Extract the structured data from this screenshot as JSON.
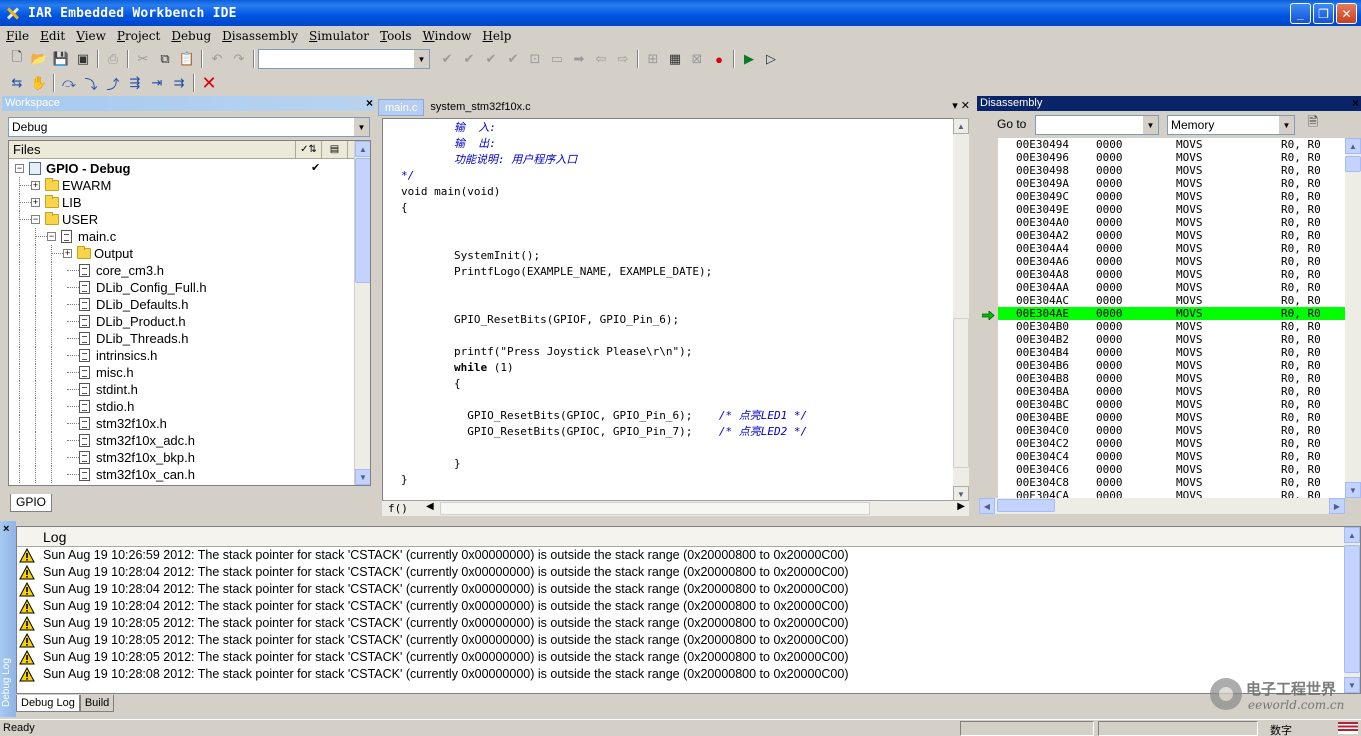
{
  "window": {
    "title": "IAR Embedded Workbench IDE"
  },
  "menu": [
    "File",
    "Edit",
    "View",
    "Project",
    "Debug",
    "Disassembly",
    "Simulator",
    "Tools",
    "Window",
    "Help"
  ],
  "workspace": {
    "header": "Workspace",
    "config": "Debug",
    "files_header": "Files",
    "bottom_tab": "GPIO",
    "tree": [
      {
        "label": "GPIO - Debug",
        "depth": 0,
        "type": "project",
        "expander": "-",
        "checked": true
      },
      {
        "label": "EWARM",
        "depth": 1,
        "type": "folder",
        "expander": "+"
      },
      {
        "label": "LIB",
        "depth": 1,
        "type": "folder",
        "expander": "+"
      },
      {
        "label": "USER",
        "depth": 1,
        "type": "folder",
        "expander": "-"
      },
      {
        "label": "main.c",
        "depth": 2,
        "type": "file",
        "expander": "-"
      },
      {
        "label": "Output",
        "depth": 3,
        "type": "folder",
        "expander": "+"
      },
      {
        "label": "core_cm3.h",
        "depth": 3,
        "type": "file"
      },
      {
        "label": "DLib_Config_Full.h",
        "depth": 3,
        "type": "file"
      },
      {
        "label": "DLib_Defaults.h",
        "depth": 3,
        "type": "file"
      },
      {
        "label": "DLib_Product.h",
        "depth": 3,
        "type": "file"
      },
      {
        "label": "DLib_Threads.h",
        "depth": 3,
        "type": "file"
      },
      {
        "label": "intrinsics.h",
        "depth": 3,
        "type": "file"
      },
      {
        "label": "misc.h",
        "depth": 3,
        "type": "file"
      },
      {
        "label": "stdint.h",
        "depth": 3,
        "type": "file"
      },
      {
        "label": "stdio.h",
        "depth": 3,
        "type": "file"
      },
      {
        "label": "stm32f10x.h",
        "depth": 3,
        "type": "file"
      },
      {
        "label": "stm32f10x_adc.h",
        "depth": 3,
        "type": "file"
      },
      {
        "label": "stm32f10x_bkp.h",
        "depth": 3,
        "type": "file"
      },
      {
        "label": "stm32f10x_can.h",
        "depth": 3,
        "type": "file"
      }
    ]
  },
  "editor": {
    "tabs": [
      "main.c",
      "system_stm32f10x.c"
    ],
    "active_tab": 0,
    "footer_tab": "f()",
    "lines": [
      {
        "text": "        输  入:",
        "class": "cm"
      },
      {
        "text": "        输  出:",
        "class": "cm"
      },
      {
        "text": "        功能说明: 用户程序入口",
        "class": "cm"
      },
      {
        "text": "*/",
        "class": "cm"
      },
      {
        "text": "void main(void)",
        "class": ""
      },
      {
        "text": "{",
        "class": ""
      },
      {
        "text": "",
        "class": ""
      },
      {
        "text": "",
        "class": ""
      },
      {
        "text": "        SystemInit();",
        "class": ""
      },
      {
        "text": "        PrintfLogo(EXAMPLE_NAME, EXAMPLE_DATE);",
        "class": ""
      },
      {
        "text": "",
        "class": ""
      },
      {
        "text": "",
        "class": ""
      },
      {
        "text": "        GPIO_ResetBits(GPIOF, GPIO_Pin_6);",
        "class": ""
      },
      {
        "text": "",
        "class": ""
      },
      {
        "text": "        printf(\"Press Joystick Please\\r\\n\");",
        "class": ""
      },
      {
        "text": "        while (1)",
        "class": "kwline"
      },
      {
        "text": "        {",
        "class": ""
      },
      {
        "text": "",
        "class": ""
      },
      {
        "text": "          GPIO_ResetBits(GPIOC, GPIO_Pin_6);",
        "comment": "    /* 点亮LED1 */",
        "class": ""
      },
      {
        "text": "          GPIO_ResetBits(GPIOC, GPIO_Pin_7);",
        "comment": "    /* 点亮LED2 */",
        "class": ""
      },
      {
        "text": "",
        "class": ""
      },
      {
        "text": "        }",
        "class": ""
      },
      {
        "text": "}",
        "class": ""
      }
    ]
  },
  "disassembly": {
    "header": "Disassembly",
    "goto_label": "Go to",
    "memory_combo": "Memory",
    "current_index": 13,
    "rows": [
      {
        "addr": "00E30494",
        "code": "0000",
        "op": "MOVS",
        "args": "R0, R0"
      },
      {
        "addr": "00E30496",
        "code": "0000",
        "op": "MOVS",
        "args": "R0, R0"
      },
      {
        "addr": "00E30498",
        "code": "0000",
        "op": "MOVS",
        "args": "R0, R0"
      },
      {
        "addr": "00E3049A",
        "code": "0000",
        "op": "MOVS",
        "args": "R0, R0"
      },
      {
        "addr": "00E3049C",
        "code": "0000",
        "op": "MOVS",
        "args": "R0, R0"
      },
      {
        "addr": "00E3049E",
        "code": "0000",
        "op": "MOVS",
        "args": "R0, R0"
      },
      {
        "addr": "00E304A0",
        "code": "0000",
        "op": "MOVS",
        "args": "R0, R0"
      },
      {
        "addr": "00E304A2",
        "code": "0000",
        "op": "MOVS",
        "args": "R0, R0"
      },
      {
        "addr": "00E304A4",
        "code": "0000",
        "op": "MOVS",
        "args": "R0, R0"
      },
      {
        "addr": "00E304A6",
        "code": "0000",
        "op": "MOVS",
        "args": "R0, R0"
      },
      {
        "addr": "00E304A8",
        "code": "0000",
        "op": "MOVS",
        "args": "R0, R0"
      },
      {
        "addr": "00E304AA",
        "code": "0000",
        "op": "MOVS",
        "args": "R0, R0"
      },
      {
        "addr": "00E304AC",
        "code": "0000",
        "op": "MOVS",
        "args": "R0, R0"
      },
      {
        "addr": "00E304AE",
        "code": "0000",
        "op": "MOVS",
        "args": "R0, R0"
      },
      {
        "addr": "00E304B0",
        "code": "0000",
        "op": "MOVS",
        "args": "R0, R0"
      },
      {
        "addr": "00E304B2",
        "code": "0000",
        "op": "MOVS",
        "args": "R0, R0"
      },
      {
        "addr": "00E304B4",
        "code": "0000",
        "op": "MOVS",
        "args": "R0, R0"
      },
      {
        "addr": "00E304B6",
        "code": "0000",
        "op": "MOVS",
        "args": "R0, R0"
      },
      {
        "addr": "00E304B8",
        "code": "0000",
        "op": "MOVS",
        "args": "R0, R0"
      },
      {
        "addr": "00E304BA",
        "code": "0000",
        "op": "MOVS",
        "args": "R0, R0"
      },
      {
        "addr": "00E304BC",
        "code": "0000",
        "op": "MOVS",
        "args": "R0, R0"
      },
      {
        "addr": "00E304BE",
        "code": "0000",
        "op": "MOVS",
        "args": "R0, R0"
      },
      {
        "addr": "00E304C0",
        "code": "0000",
        "op": "MOVS",
        "args": "R0, R0"
      },
      {
        "addr": "00E304C2",
        "code": "0000",
        "op": "MOVS",
        "args": "R0, R0"
      },
      {
        "addr": "00E304C4",
        "code": "0000",
        "op": "MOVS",
        "args": "R0, R0"
      },
      {
        "addr": "00E304C6",
        "code": "0000",
        "op": "MOVS",
        "args": "R0, R0"
      },
      {
        "addr": "00E304C8",
        "code": "0000",
        "op": "MOVS",
        "args": "R0, R0"
      },
      {
        "addr": "00E304CA",
        "code": "0000",
        "op": "MOVS",
        "args": "R0, R0"
      }
    ]
  },
  "log": {
    "header": "Log",
    "side_label": "Debug Log",
    "tabs": [
      "Debug Log",
      "Build"
    ],
    "entries": [
      "Sun Aug 19 10:26:59 2012: The stack pointer for stack 'CSTACK' (currently 0x00000000) is outside the stack range (0x20000800 to 0x20000C00)",
      "Sun Aug 19 10:28:04 2012: The stack pointer for stack 'CSTACK' (currently 0x00000000) is outside the stack range (0x20000800 to 0x20000C00)",
      "Sun Aug 19 10:28:04 2012: The stack pointer for stack 'CSTACK' (currently 0x00000000) is outside the stack range (0x20000800 to 0x20000C00)",
      "Sun Aug 19 10:28:04 2012: The stack pointer for stack 'CSTACK' (currently 0x00000000) is outside the stack range (0x20000800 to 0x20000C00)",
      "Sun Aug 19 10:28:05 2012: The stack pointer for stack 'CSTACK' (currently 0x00000000) is outside the stack range (0x20000800 to 0x20000C00)",
      "Sun Aug 19 10:28:05 2012: The stack pointer for stack 'CSTACK' (currently 0x00000000) is outside the stack range (0x20000800 to 0x20000C00)",
      "Sun Aug 19 10:28:05 2012: The stack pointer for stack 'CSTACK' (currently 0x00000000) is outside the stack range (0x20000800 to 0x20000C00)",
      "Sun Aug 19 10:28:08 2012: The stack pointer for stack 'CSTACK' (currently 0x00000000) is outside the stack range (0x20000800 to 0x20000C00)"
    ]
  },
  "status": {
    "text": "Ready",
    "ime": "数字"
  },
  "watermark": {
    "cn": "电子工程世界",
    "en": "eeworld.com.cn"
  },
  "colors": {
    "current_line": "#00ff00",
    "titlebar": "#0054e3",
    "comment": "#0000c8",
    "stop": "#d9000d"
  }
}
